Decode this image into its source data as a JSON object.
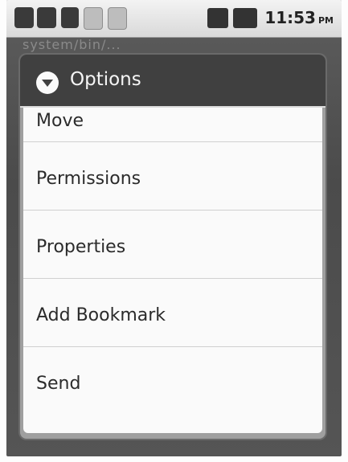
{
  "status_bar": {
    "time": "11:53",
    "ampm": "PM",
    "icons": [
      "usb-icon",
      "sd-card-icon",
      "usb-debug-icon",
      "download-icon",
      "notification-icon",
      "signal-icon",
      "battery-icon"
    ]
  },
  "background": {
    "title": "system/bin/..."
  },
  "dialog": {
    "title": "Options",
    "header_icon": "menu-circle-icon",
    "items": [
      {
        "label": "Move"
      },
      {
        "label": "Permissions"
      },
      {
        "label": "Properties"
      },
      {
        "label": "Add Bookmark"
      },
      {
        "label": "Send"
      }
    ]
  }
}
